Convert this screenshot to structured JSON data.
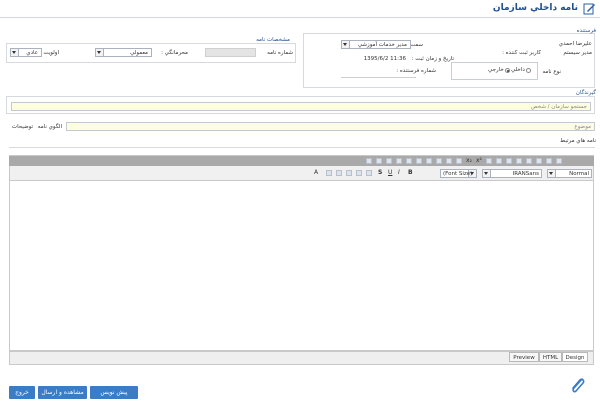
{
  "header": {
    "title": "نامه داخلي سازمان"
  },
  "sender": {
    "section_label": "فرستنده",
    "name": "عليرضا احمدي",
    "position_label": "سمت :",
    "position_value": "مدير خدمات آموزشي",
    "registrar_label": "كاربر ثبت كننده :",
    "registrar_value": "مدير سيستم",
    "datetime_label": "تاريخ و زمان ثبت :",
    "datetime_value": "11:36 1395/6/2",
    "letter_type_label": "نوع نامه",
    "type_internal": "داخلي",
    "type_external": "خارجي",
    "sender_number_label": "شماره فرستنده :"
  },
  "letter_specs": {
    "section_label": "مشخصات نامه",
    "letter_number_label": "شماره نامه",
    "confidentiality_label": "محرمانگي :",
    "confidentiality_value": "معمولي",
    "priority_label": "اولويت",
    "priority_value": "عادي"
  },
  "recipients": {
    "section_label": "گيرندگان",
    "search_placeholder": "جستجو سازمان / شخص"
  },
  "subject": {
    "placeholder": "موضوع",
    "template_label": "الگوي نامه",
    "description_label": "توضيحات"
  },
  "related": {
    "label": "نامه هاي مرتبط"
  },
  "editor": {
    "format_value": "Normal",
    "font_value": "IRANSans",
    "font_size_value": "(Font Size)",
    "tabs": [
      "Preview",
      "HTML",
      "Design"
    ]
  },
  "footer": {
    "draft_button": "پيش نويس",
    "view_send_button": "مشاهده و ارسال",
    "exit_button": "خروج"
  },
  "colors": {
    "accent": "#3a7cc5",
    "title": "#1f4e8c",
    "editor_header": "#a9a9a9"
  }
}
